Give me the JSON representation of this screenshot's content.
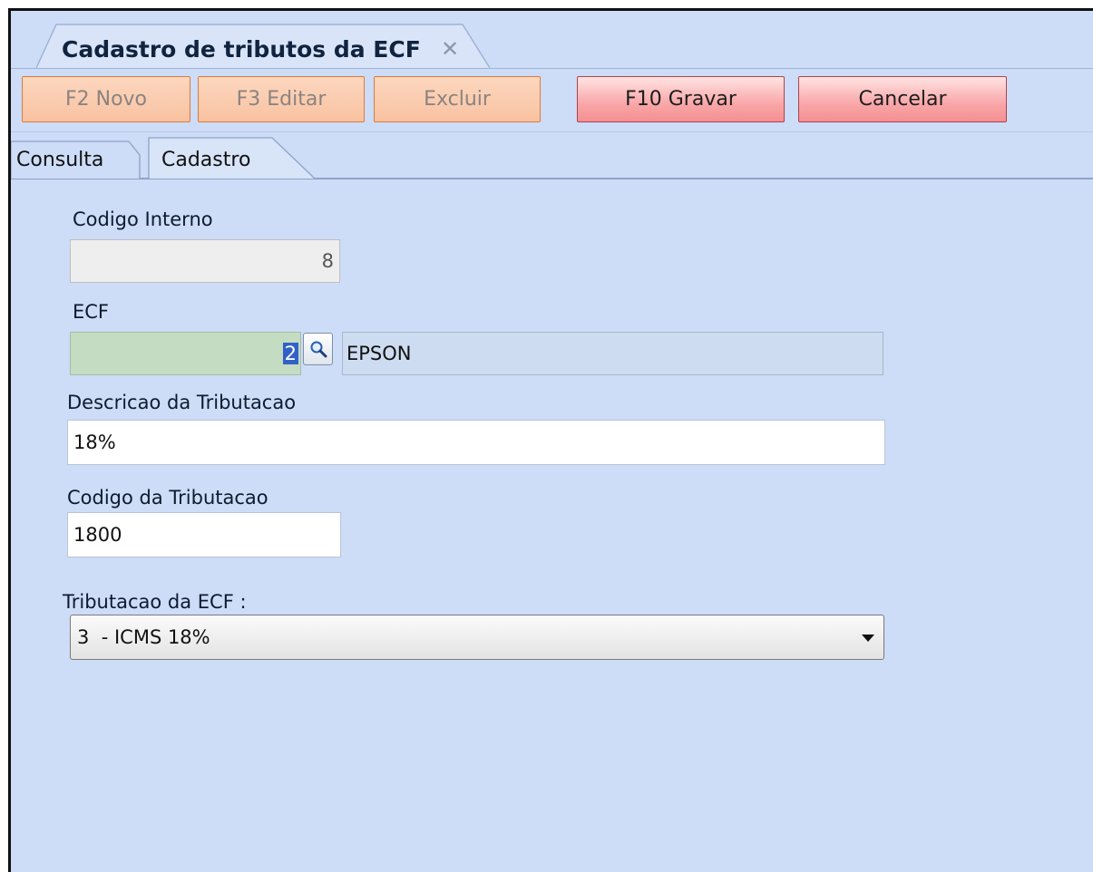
{
  "document_tab": {
    "title": "Cadastro de tributos da ECF",
    "close_icon": "close-icon"
  },
  "toolbar": {
    "new_label": "F2 Novo",
    "edit_label": "F3 Editar",
    "delete_label": "Excluir",
    "save_label": "F10 Gravar",
    "cancel_label": "Cancelar"
  },
  "page_tabs": {
    "consulta": "Consulta",
    "cadastro": "Cadastro"
  },
  "form": {
    "codigo_interno": {
      "label": "Codigo Interno",
      "value": "8"
    },
    "ecf": {
      "label": "ECF",
      "code": "2",
      "name": "EPSON",
      "lookup_icon": "magnifier-icon"
    },
    "descricao": {
      "label": "Descricao da Tributacao",
      "value": "18%"
    },
    "codigo_tributacao": {
      "label": "Codigo da Tributacao",
      "value": "1800"
    },
    "tributacao_ecf": {
      "label": "Tributacao da ECF :",
      "selected": "3  - ICMS 18%"
    }
  },
  "colors": {
    "window_bg": "#cddcf7",
    "disabled_button": "#f9c2a1",
    "active_button": "#f48f93",
    "lookup_field": "#c4dcc1"
  }
}
